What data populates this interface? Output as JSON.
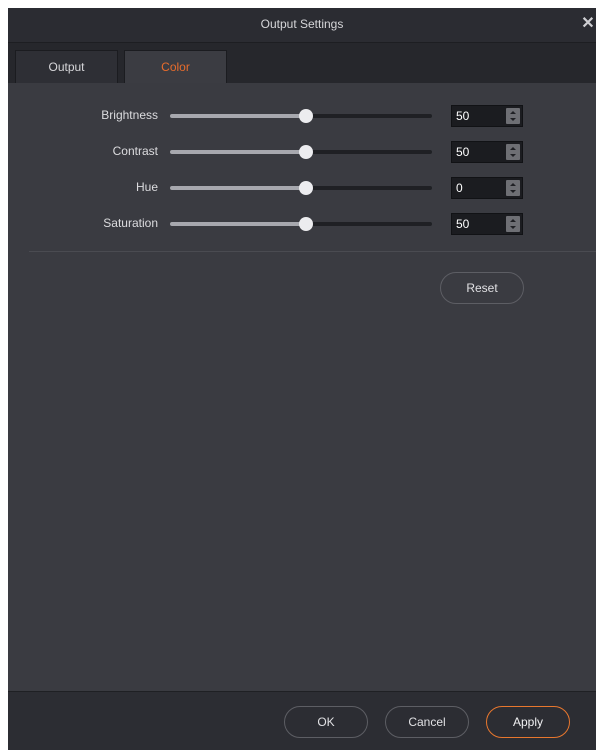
{
  "dialog": {
    "title": "Output Settings",
    "close_glyph": "✕"
  },
  "tabs": [
    {
      "label": "Output",
      "active": false
    },
    {
      "label": "Color",
      "active": true
    }
  ],
  "adjustments": [
    {
      "label": "Brightness",
      "value": "50",
      "fraction": 0.5
    },
    {
      "label": "Contrast",
      "value": "50",
      "fraction": 0.5
    },
    {
      "label": "Hue",
      "value": "0",
      "fraction": 0.5
    },
    {
      "label": "Saturation",
      "value": "50",
      "fraction": 0.5
    }
  ],
  "reset_label": "Reset",
  "footer": {
    "ok_label": "OK",
    "cancel_label": "Cancel",
    "apply_label": "Apply"
  },
  "colors": {
    "accent": "#e86c2c",
    "panel": "#3a3b41",
    "titlebar": "#2b2c32"
  },
  "icons": {
    "close": "close-icon",
    "spin_up": "arrow-up-icon",
    "spin_down": "arrow-down-icon"
  }
}
